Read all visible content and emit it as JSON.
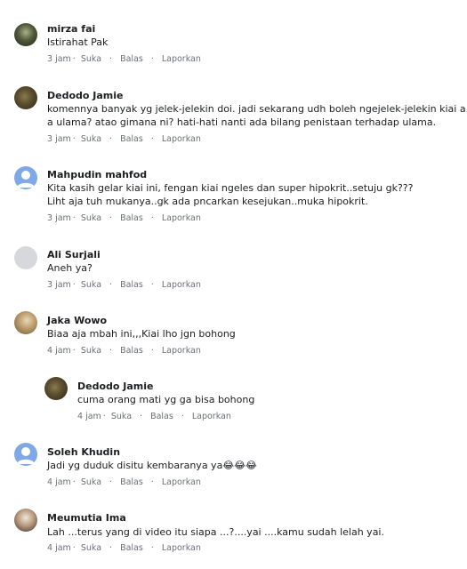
{
  "comments": [
    {
      "name": "mirza fai",
      "lines": [
        "Istirahat Pak"
      ],
      "time": "3 jam",
      "avatar": "mirza-avatar"
    },
    {
      "name": "Dedodo Jamie",
      "lines": [
        "komennya banyak yg jelek-jelekin doi. jadi sekarang udh boleh ngejelek-jelekin kiai a.k.",
        "a ulama? atao gimana ni? hati-hati nanti ada bilang penistaan terhadap ulama."
      ],
      "time": "3 jam",
      "avatar": "dedodo-avatar"
    },
    {
      "name": "Mahpudin mahfod",
      "lines": [
        "Kita kasih gelar kiai ini, fengan kiai ngeles dan super hipokrit..setuju gk???",
        "Liht aja tuh mukanya..gk ada pncarkan kesejukan..muka hipokrit."
      ],
      "time": "3 jam",
      "avatar": "default-avatar"
    },
    {
      "name": "Ali Surjali",
      "lines": [
        "Aneh ya?"
      ],
      "time": "3 jam",
      "avatar": "grey-avatar"
    },
    {
      "name": "Jaka Wowo",
      "lines": [
        "Biaa aja mbah ini,,,Kiai lho jgn bohong"
      ],
      "time": "4 jam",
      "avatar": "jaka-avatar"
    },
    {
      "name": "Dedodo Jamie",
      "lines": [
        "cuma orang mati yg ga bisa bohong"
      ],
      "time": "4 jam",
      "avatar": "dedodo-avatar"
    },
    {
      "name": "Soleh Khudin",
      "lines": [
        "Jadi yg duduk disitu kembaranya ya😂😂😂"
      ],
      "time": "4 jam",
      "avatar": "default-avatar"
    },
    {
      "name": "Meumutia Ima",
      "lines": [
        "Lah ...terus yang di video itu siapa ...?....yai ....kamu sudah lelah yai."
      ],
      "time": "4 jam",
      "avatar": "meumutia-avatar"
    }
  ],
  "actions": {
    "like": "Suka",
    "reply": "Balas",
    "report": "Laporkan",
    "dot": "·"
  }
}
